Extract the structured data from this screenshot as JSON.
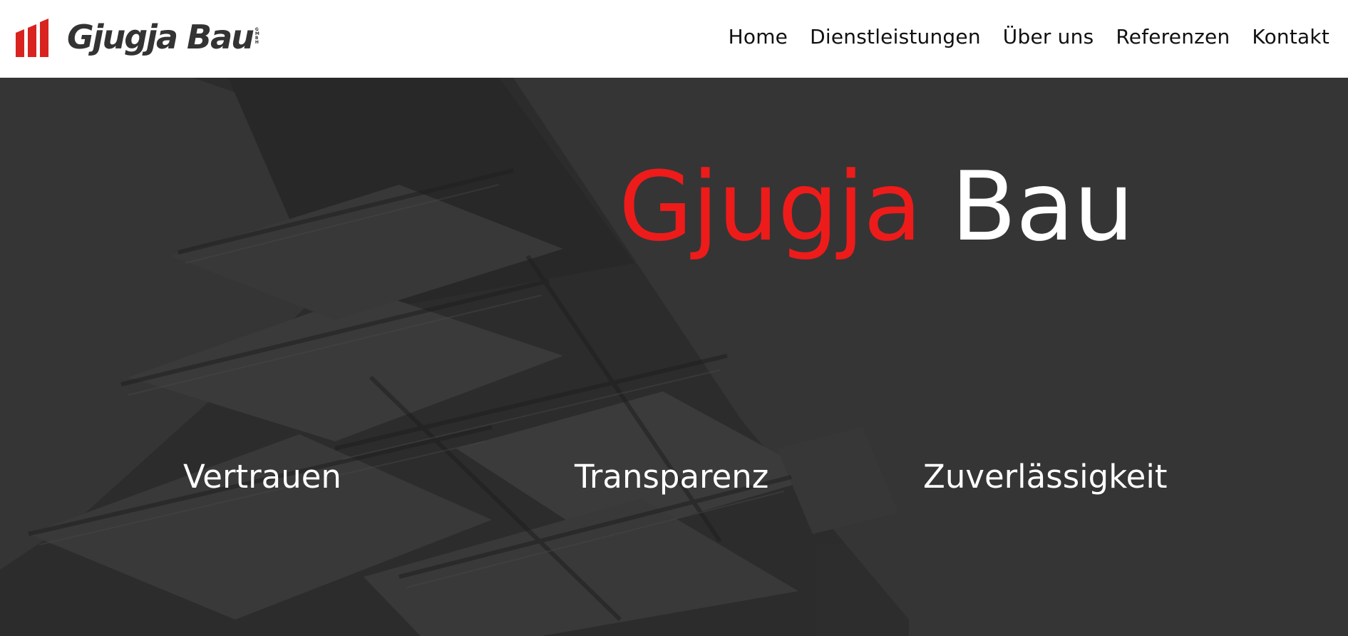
{
  "header": {
    "logo_text": "Gjugja Bau",
    "logo_small": [
      "G",
      "M",
      "B",
      "H"
    ],
    "nav": [
      {
        "label": "Home"
      },
      {
        "label": "Dienstleistungen"
      },
      {
        "label": "Über uns"
      },
      {
        "label": "Referenzen"
      },
      {
        "label": "Kontakt"
      }
    ]
  },
  "hero": {
    "title_part1": "Gjugja",
    "title_part2": "Bau",
    "values": [
      "Vertrauen",
      "Transparenz",
      "Zuverlässigkeit"
    ]
  },
  "colors": {
    "brand_red": "#ee1b1b",
    "hero_overlay": "#343434",
    "text_dark": "#111111"
  },
  "icons": {
    "logo_mark": "building-bars-icon"
  }
}
